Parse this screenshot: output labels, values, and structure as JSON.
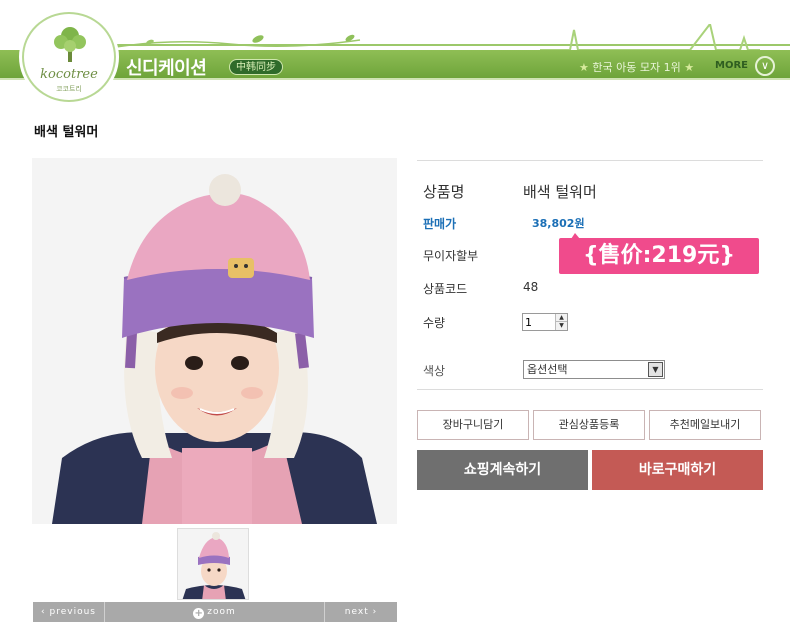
{
  "header": {
    "logo_text": "kocotree",
    "logo_sub": "코코트리",
    "brand_title": "신디케이션",
    "sync_badge": "中韩同步",
    "rank_text": "한국 아동 모자 1위",
    "more_label": "MORE",
    "colors": {
      "band": "#7bb044",
      "badge": "#2f6b2a"
    }
  },
  "product": {
    "title": "배색 털워머",
    "name_label": "상품명",
    "name_value": "배색 털워머",
    "price_label": "판매가",
    "price_value": "38,802원",
    "promo_text": "{售价:219元}",
    "installment_label": "무이자할부",
    "code_label": "상품코드",
    "code_value": "48",
    "qty_label": "수량",
    "qty_value": "1",
    "color_label": "색상",
    "color_select_value": "옵션선택"
  },
  "gallery": {
    "prev_label": "previous",
    "zoom_label": "zoom",
    "next_label": "next"
  },
  "actions": {
    "cart_label": "장바구니담기",
    "wish_label": "관심상품등록",
    "recommend_label": "추천메일보내기",
    "continue_label": "쇼핑계속하기",
    "buy_label": "바로구매하기",
    "colors": {
      "continue": "#6f6f6f",
      "buy": "#c45a55",
      "promo": "#f04b8c",
      "price": "#1b6fb6"
    }
  }
}
